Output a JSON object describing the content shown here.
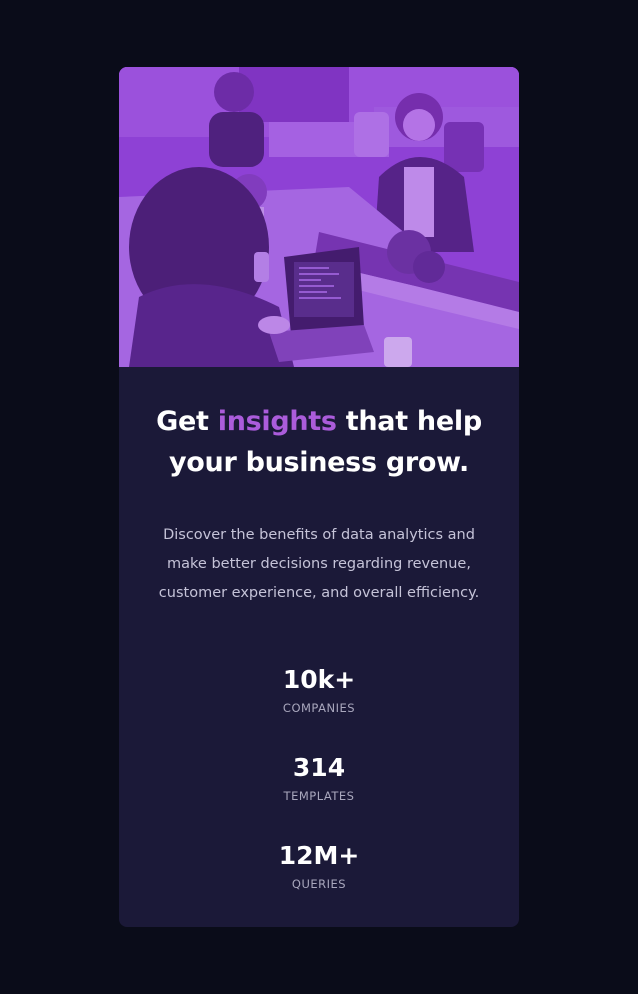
{
  "colors": {
    "page_background": "#0a0c19",
    "card_background": "#1b1938",
    "accent": "#ab5cdb",
    "image_tint": "#8c3fd4"
  },
  "hero_image": {
    "icon": "office-team-photo"
  },
  "heading": {
    "prefix": "Get ",
    "accent": "insights",
    "suffix": " that help your business grow."
  },
  "description": "Discover the benefits of data analytics and make better decisions regarding revenue, customer experience, and overall efficiency.",
  "stats": [
    {
      "value": "10k+",
      "label": "COMPANIES"
    },
    {
      "value": "314",
      "label": "TEMPLATES"
    },
    {
      "value": "12M+",
      "label": "QUERIES"
    }
  ]
}
